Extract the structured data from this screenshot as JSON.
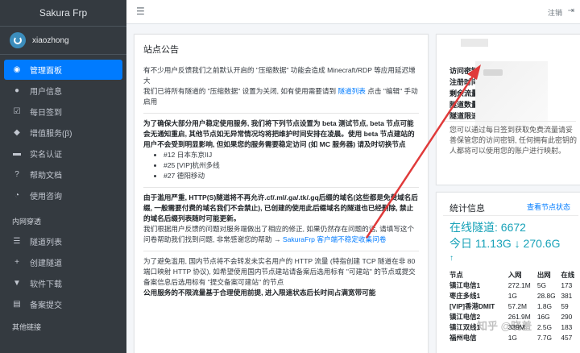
{
  "brand": "Sakura Frp",
  "user": {
    "name": "xiaozhong"
  },
  "nav": [
    {
      "icon": "dashboard-icon",
      "glyph": "◉",
      "label": "管理面板",
      "active": true
    },
    {
      "icon": "user-icon",
      "glyph": "●",
      "label": "用户信息"
    },
    {
      "icon": "checkin-icon",
      "glyph": "☑",
      "label": "每日签到"
    },
    {
      "icon": "diamond-icon",
      "glyph": "◆",
      "label": "增值服务(β)"
    },
    {
      "icon": "id-card-icon",
      "glyph": "▬",
      "label": "实名认证"
    },
    {
      "icon": "help-icon",
      "glyph": "?",
      "label": "帮助文档"
    },
    {
      "icon": "chat-icon",
      "glyph": "◔",
      "label": "使用咨询"
    }
  ],
  "nav_header_tunnel": "内网穿透",
  "nav2": [
    {
      "icon": "list-icon",
      "glyph": "☰",
      "label": "隧道列表"
    },
    {
      "icon": "plus-icon",
      "glyph": "+",
      "label": "创建隧道"
    },
    {
      "icon": "download-icon",
      "glyph": "▼",
      "label": "软件下载"
    },
    {
      "icon": "file-icon",
      "glyph": "▤",
      "label": "备案提交"
    }
  ],
  "nav_header_links": "其他链接",
  "topbar": {
    "logout": "注销"
  },
  "announce": {
    "title": "站点公告",
    "p1": "有不少用户反馈我们之前默认开启的 \"压缩数据\" 功能会造成 Minecraft/RDP 等应用延迟增大",
    "p2a": "我们已将所有隧道的 \"压缩数据\" 设置为关闭, 如有使用需要请到 ",
    "p2link": "隧道列表",
    "p2b": " 点击 \"编辑\" 手动启用",
    "p3": "为了确保大部分用户稳定使用服务, 我们将下列节点设置为 beta 测试节点, beta 节点可能会无通知重启, 其他节点如无异常情况均将把维护时间安排在凌晨。使用 beta 节点建站的用户不会受到明显影响, 但如果您的服务需要稳定访问 (如 MC 服务器) 请及时切换节点",
    "beta_nodes": [
      "#12 日本东京IIJ",
      "#25 [VIP]杭州多线",
      "#27 德阳移动"
    ],
    "p4": "由于滥用严重, HTTP(S)隧道将不再允许.cf/.ml/.ga/.tk/.gq后缀的域名(这些都是免费域名后缀, 一般需要付费的域名我们不会禁止), 已创建的使用此后缀域名的隧道也已经删除, 禁止的域名后缀列表随时可能更新。",
    "p5a": "我们根据用户反馈的问题对服务端做出了相应的修正, 如果仍然存在问题的话, 请填写这个问卷帮助我们找到问题, 非常感谢您的帮助 → ",
    "p5link": "SakuraFrp 客户端不稳定收集问卷",
    "p6": "为了避免滥用, 国内节点将不会转发未实名用户的 HTTP 流量 (特指创建 TCP 隧道在非 80 端口映射 HTTP 协议), 如希望使用国内节点建站请备案后选用标有 \"可建站\" 的节点或提交备案信息后选用标有 \"提交备案可建站\" 的节点",
    "p7": "公用服务的不限流量基于合理使用前提, 进入限速状态后长时间占满宽带可能"
  },
  "key": {
    "labels": [
      "访问密钥",
      "注册时间",
      "剩余流量",
      "隧道数量",
      "隧道限速"
    ],
    "desc": "您可以通过每日签到获取免费流量请妥善保管您的访问密钥, 任何拥有此密钥的人都将可以使用您的账户进行映射。"
  },
  "stats": {
    "title": "统计信息",
    "more": "查看节点状态",
    "tunnels": "在线隧道: 6672",
    "traffic": "今日 11.13G ↓ 270.6G",
    "down_arrow": "↑",
    "headers": [
      "节点",
      "入网",
      "出网",
      "在线"
    ],
    "rows": [
      [
        "镇江电信1",
        "272.1M",
        "5G",
        "173"
      ],
      [
        "枣庄多线1",
        "1G",
        "28.8G",
        "381"
      ],
      [
        "[VIP]香港DMIT",
        "57.2M",
        "1.8G",
        "59"
      ],
      [
        "镇江电信2",
        "261.9M",
        "16G",
        "290"
      ],
      [
        "镇江双线1",
        "339M",
        "2.5G",
        "183"
      ],
      [
        "福州电信",
        "1G",
        "7.7G",
        "457"
      ]
    ]
  },
  "watermark": "知乎 @晓羞",
  "colors": {
    "sidebar": "#343a40",
    "active": "#007bff",
    "accent": "#17a2b8",
    "arrow": "#e03a3a"
  }
}
